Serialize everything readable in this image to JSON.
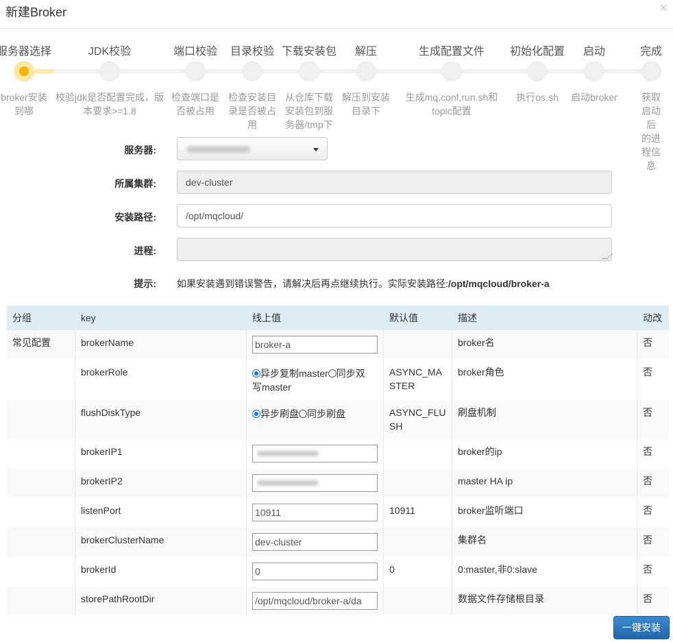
{
  "modal": {
    "title": "新建Broker",
    "close": "×"
  },
  "wizard": {
    "steps": [
      {
        "title": "服务器选择",
        "desc": "broker安装\n到哪"
      },
      {
        "title": "JDK校验",
        "desc": "校验jdk是否配置完成，版\n本要求>=1.8"
      },
      {
        "title": "端口校验",
        "desc": "检查端口是\n否被占用"
      },
      {
        "title": "目录校验",
        "desc": "检查安装目\n录是否被占\n用"
      },
      {
        "title": "下载安装包",
        "desc": "从仓库下载\n安装包到服\n务器/tmp下"
      },
      {
        "title": "解压",
        "desc": "解压到安装\n目录下"
      },
      {
        "title": "生成配置文件",
        "desc": "生成mq.conf,run.sh和\ntopic配置"
      },
      {
        "title": "初始化配置",
        "desc": "执行os.sh"
      },
      {
        "title": "启动",
        "desc": "启动broker"
      },
      {
        "title": "完成",
        "desc": "获取启动后\n的进程信息"
      }
    ],
    "current_step": 0
  },
  "form": {
    "server_label": "服务器:",
    "cluster_label": "所属集群:",
    "cluster_value": "dev-cluster",
    "path_label": "安装路径:",
    "path_value": "/opt/mqcloud/",
    "progress_label": "进程:",
    "hint_label": "提示:",
    "hint_text": "如果安装遇到错误警告，请解决后再点继续执行。实际安装路径:",
    "hint_path": "/opt/mqcloud/broker-a"
  },
  "table": {
    "headers": [
      "分组",
      "key",
      "线上值",
      "默认值",
      "描述",
      "动改"
    ],
    "group": "常见配置",
    "rows": [
      {
        "key": "brokerName",
        "value": "broker-a",
        "default": "",
        "desc": "broker名",
        "dynamic": "否"
      },
      {
        "key": "brokerRole",
        "radio1": "异步复制master",
        "radio2": "同步双",
        "radio2b": "写master",
        "default": "ASYNC_MA",
        "default2": "STER",
        "desc": "broker角色",
        "dynamic": "否"
      },
      {
        "key": "flushDiskType",
        "radio1": "异步刷盘",
        "radio2": "同步刷盘",
        "default": "ASYNC_FLU",
        "default2": "SH",
        "desc": "刷盘机制",
        "dynamic": "否"
      },
      {
        "key": "brokerIP1",
        "value": "",
        "default": "",
        "desc": "broker的ip",
        "dynamic": "否"
      },
      {
        "key": "brokerIP2",
        "value": "",
        "default": "",
        "desc": "master HA ip",
        "dynamic": "否"
      },
      {
        "key": "listenPort",
        "value": "10911",
        "default": "10911",
        "desc": "broker监听端口",
        "dynamic": "否"
      },
      {
        "key": "brokerClusterName",
        "value": "dev-cluster",
        "default": "",
        "desc": "集群名",
        "dynamic": "否"
      },
      {
        "key": "brokerId",
        "value": "0",
        "default": "0",
        "desc": "0:master,非0:slave",
        "dynamic": "否"
      },
      {
        "key": "storePathRootDir",
        "value": "/opt/mqcloud/broker-a/da",
        "default": "",
        "desc": "数据文件存储根目录",
        "dynamic": "否"
      }
    ]
  },
  "install_button": "一键安装"
}
